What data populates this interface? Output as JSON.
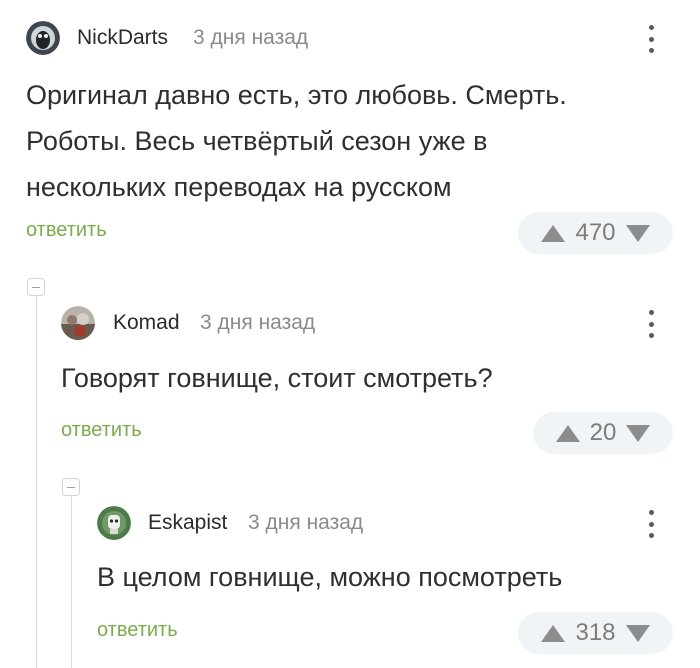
{
  "comments": [
    {
      "author": "NickDarts",
      "time": "3 дня назад",
      "text": "Оригинал давно есть, это любовь. Смерть. Роботы. Весь четвёртый сезон уже в нескольких переводах на русском",
      "reply_label": "ответить",
      "score": "470"
    },
    {
      "author": "Komad",
      "time": "3 дня назад",
      "text": "Говорят говнище, стоит смотреть?",
      "reply_label": "ответить",
      "score": "20"
    },
    {
      "author": "Eskapist",
      "time": "3 дня назад",
      "text": "В целом говнище, можно посмотреть",
      "reply_label": "ответить",
      "score": "318"
    }
  ],
  "icons": {
    "menu": "more-vertical-icon",
    "upvote": "arrow-up-icon",
    "downvote": "arrow-down-icon",
    "collapse": "collapse-minus-icon"
  },
  "colors": {
    "reply": "#7bab4d",
    "rating_bg": "#f1f4f6",
    "text": "#2f2f2f",
    "meta": "#8a8a8a"
  }
}
